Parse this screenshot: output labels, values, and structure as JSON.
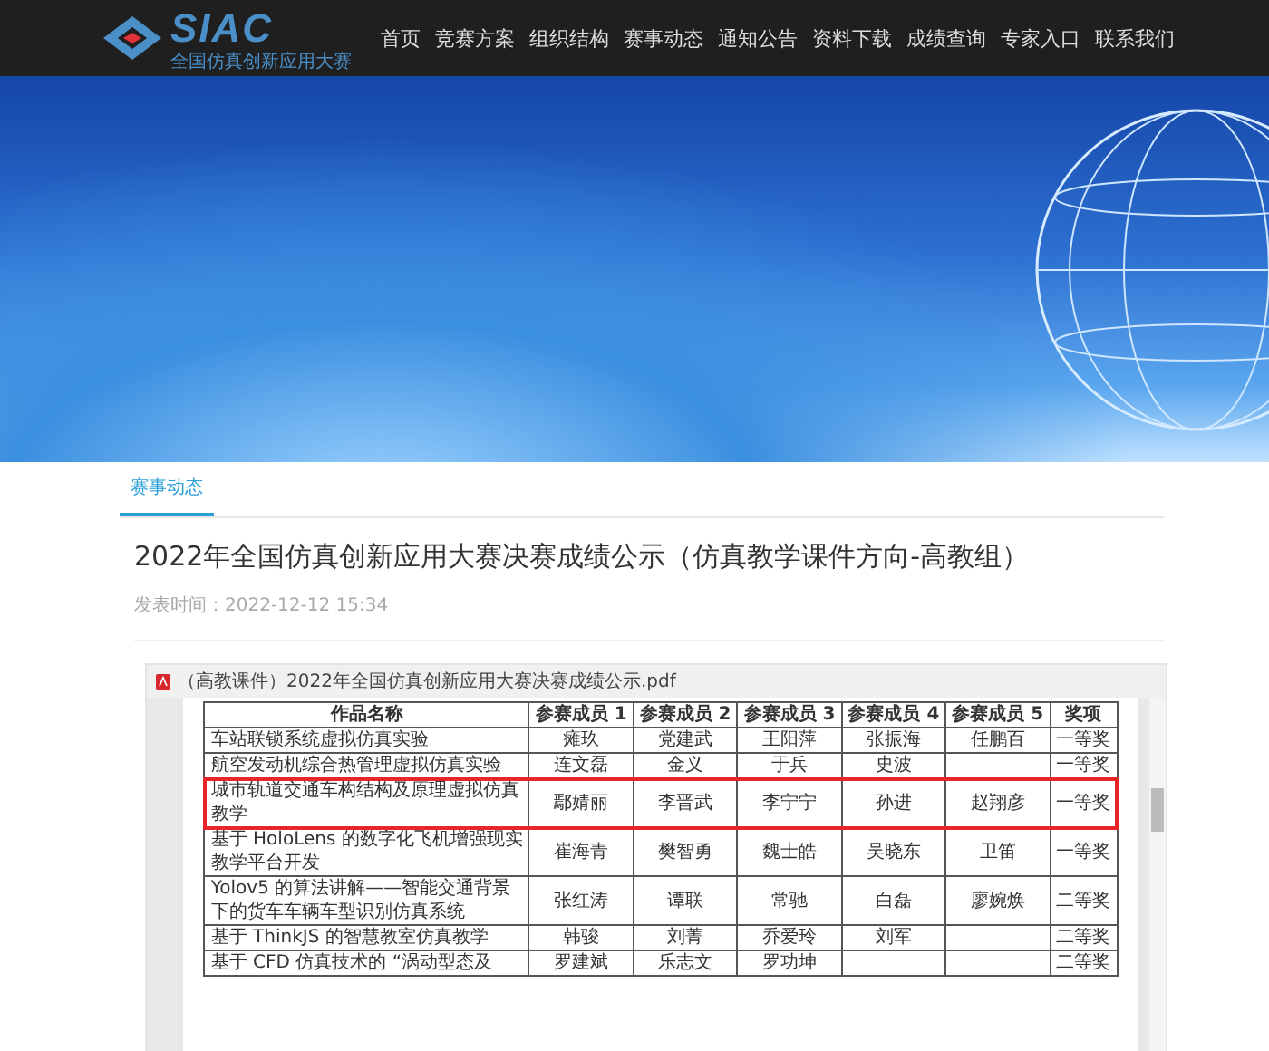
{
  "header": {
    "logo_text": "SIAC",
    "logo_subtitle": "全国仿真创新应用大赛",
    "nav": [
      {
        "label": "首页",
        "selected": false
      },
      {
        "label": "竞赛方案",
        "selected": false
      },
      {
        "label": "组织结构",
        "selected": false
      },
      {
        "label": "赛事动态",
        "selected": false
      },
      {
        "label": "通知公告",
        "selected": false
      },
      {
        "label": "资料下载",
        "selected": false
      },
      {
        "label": "成绩查询",
        "selected": false
      },
      {
        "label": "专家入口",
        "selected": false
      },
      {
        "label": "联系我们",
        "selected": false
      }
    ]
  },
  "breadcrumb_tab": {
    "label": "赛事动态",
    "selected": true
  },
  "article": {
    "title": "2022年全国仿真创新应用大赛决赛成绩公示（仿真教学课件方向-高教组）",
    "date": "发表时间：2022-12-12 15:34"
  },
  "pdf_viewer": {
    "file_name": "（高教课件）2022年全国仿真创新应用大赛决赛成绩公示.pdf",
    "table": {
      "columns": [
        "作品名称",
        "参赛成员 1",
        "参赛成员 2",
        "参赛成员 3",
        "参赛成员 4",
        "参赛成员 5",
        "奖项"
      ],
      "rows": [
        {
          "highlighted": false,
          "cells": [
            "车站联锁系统虚拟仿真实验",
            "瘫玖",
            "党建武",
            "王阳萍",
            "张振海",
            "任鹏百",
            "一等奖"
          ]
        },
        {
          "highlighted": false,
          "cells": [
            "航空发动机综合热管理虚拟仿真实验",
            "连文磊",
            "金义",
            "于兵",
            "史波",
            "",
            "一等奖"
          ]
        },
        {
          "highlighted": true,
          "cells": [
            "城市轨道交通车构结构及原理虚拟仿真教学",
            "鄢婧丽",
            "李晋武",
            "李宁宁",
            "孙进",
            "赵翔彦",
            "一等奖"
          ]
        },
        {
          "highlighted": false,
          "cells": [
            "基于 HoloLens 的数字化飞机增强现实教学平台开发",
            "崔海青",
            "樊智勇",
            "魏士皓",
            "吴晓东",
            "卫笛",
            "一等奖"
          ]
        },
        {
          "highlighted": false,
          "cells": [
            "Yolov5 的算法讲解——智能交通背景下的货车车辆车型识别仿真系统",
            "张红涛",
            "谭联",
            "常驰",
            "白磊",
            "廖婉焕",
            "二等奖"
          ]
        },
        {
          "highlighted": false,
          "cells": [
            "基于 ThinkJS 的智慧教室仿真教学",
            "韩骏",
            "刘菁",
            "乔爱玲",
            "刘军",
            "",
            "二等奖"
          ]
        },
        {
          "highlighted": false,
          "cells": [
            "基于 CFD 仿真技术的 “涡动型态及",
            "罗建斌",
            "乐志文",
            "罗功坤",
            "",
            "",
            "二等奖"
          ]
        }
      ]
    }
  }
}
